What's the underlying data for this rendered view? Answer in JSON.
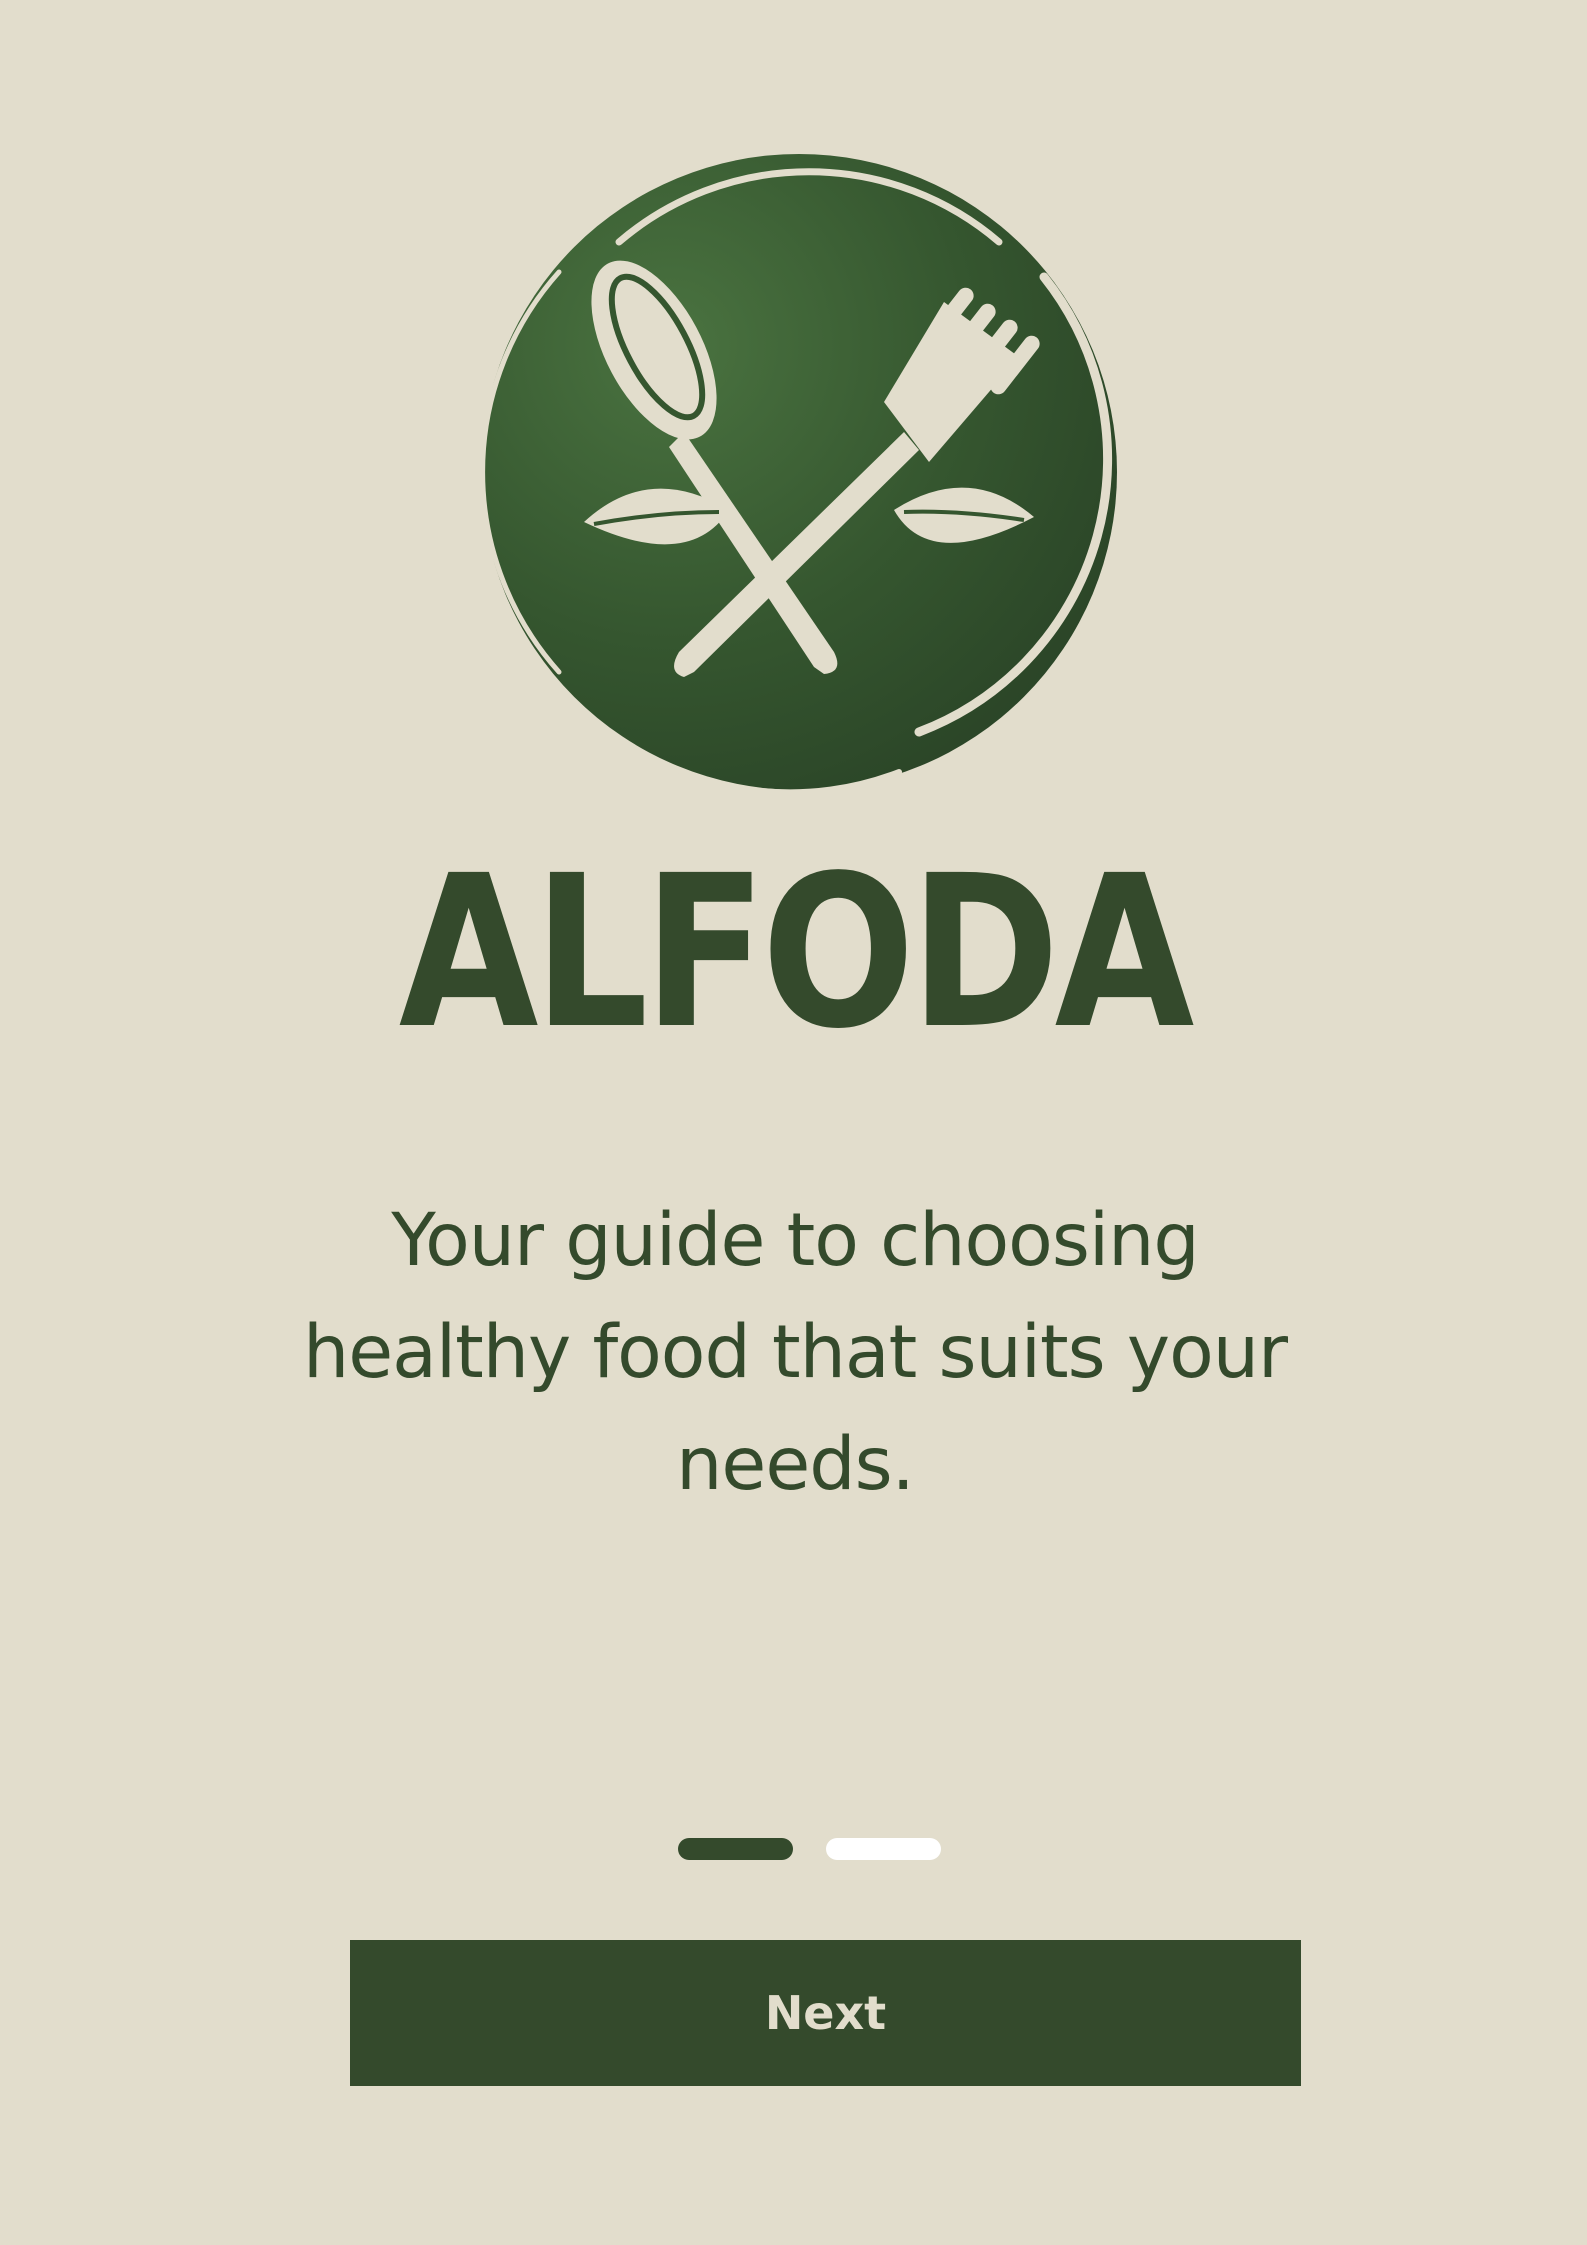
{
  "app": {
    "brand_name": "ALFODA",
    "logo_icon": "spoon-fork-leaves-icon"
  },
  "onboarding": {
    "tagline": "Your guide to choosing healthy food that suits your needs.",
    "pages_total": 2,
    "current_page": 1,
    "next_label": "Next"
  },
  "colors": {
    "background": "#e2ddcc",
    "primary": "#344a2c",
    "logo_green": "#3d6534",
    "inactive_dot": "#ffffff"
  }
}
